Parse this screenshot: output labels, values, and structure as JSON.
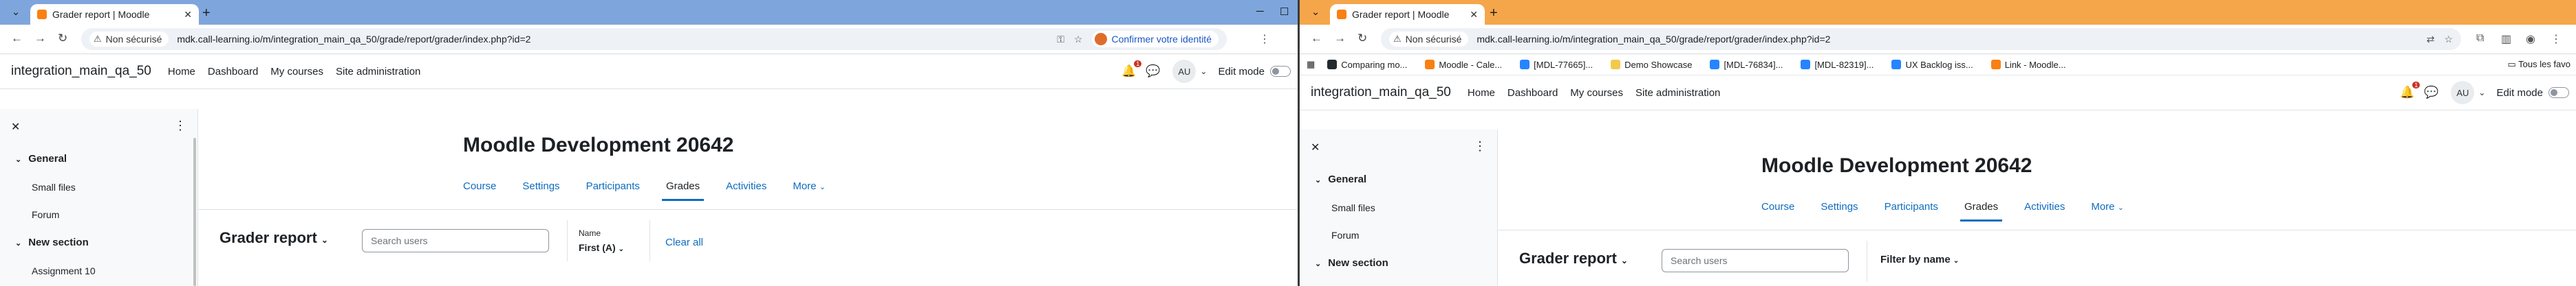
{
  "left": {
    "tab_title": "Grader report | Moodle",
    "security_label": "Non sécurisé",
    "url": "mdk.call-learning.io/m/integration_main_qa_50/grade/report/grader/index.php?id=2",
    "confirm_label": "Confirmer votre identité",
    "site_name": "integration_main_qa_50",
    "nav": [
      "Home",
      "Dashboard",
      "My courses",
      "Site administration"
    ],
    "notif_count": "1",
    "user_initials": "AU",
    "edit_mode_label": "Edit mode",
    "drawer": {
      "general": "General",
      "items": [
        "Small files",
        "Forum"
      ],
      "new_section": "New section",
      "new_items": [
        "Assignment 10"
      ]
    },
    "course_title": "Moodle Development 20642",
    "tabs": [
      "Course",
      "Settings",
      "Participants",
      "Grades",
      "Activities",
      "More"
    ],
    "report_title": "Grader report",
    "search_placeholder": "Search users",
    "name_label": "Name",
    "name_value": "First (A)",
    "clear_all": "Clear all"
  },
  "right": {
    "tab_title": "Grader report | Moodle",
    "security_label": "Non sécurisé",
    "url": "mdk.call-learning.io/m/integration_main_qa_50/grade/report/grader/index.php?id=2",
    "bookmarks": [
      {
        "label": "Comparing mo...",
        "color": "#24292f"
      },
      {
        "label": "Moodle - Cale...",
        "color": "#f98012"
      },
      {
        "label": "[MDL-77665]...",
        "color": "#2684ff"
      },
      {
        "label": "Demo Showcase",
        "color": "#f2c94c"
      },
      {
        "label": "[MDL-76834]...",
        "color": "#2684ff"
      },
      {
        "label": "[MDL-82319]...",
        "color": "#2684ff"
      },
      {
        "label": "UX Backlog iss...",
        "color": "#2684ff"
      },
      {
        "label": "Link - Moodle...",
        "color": "#f98012"
      }
    ],
    "all_bookmarks": "Tous les favo",
    "site_name": "integration_main_qa_50",
    "nav": [
      "Home",
      "Dashboard",
      "My courses",
      "Site administration"
    ],
    "notif_count": "1",
    "user_initials": "AU",
    "edit_mode_label": "Edit mode",
    "drawer": {
      "general": "General",
      "items": [
        "Small files",
        "Forum"
      ],
      "new_section": "New section"
    },
    "course_title": "Moodle Development 20642",
    "tabs": [
      "Course",
      "Settings",
      "Participants",
      "Grades",
      "Activities",
      "More"
    ],
    "report_title": "Grader report",
    "search_placeholder": "Search users",
    "filter_label": "Filter by name"
  }
}
